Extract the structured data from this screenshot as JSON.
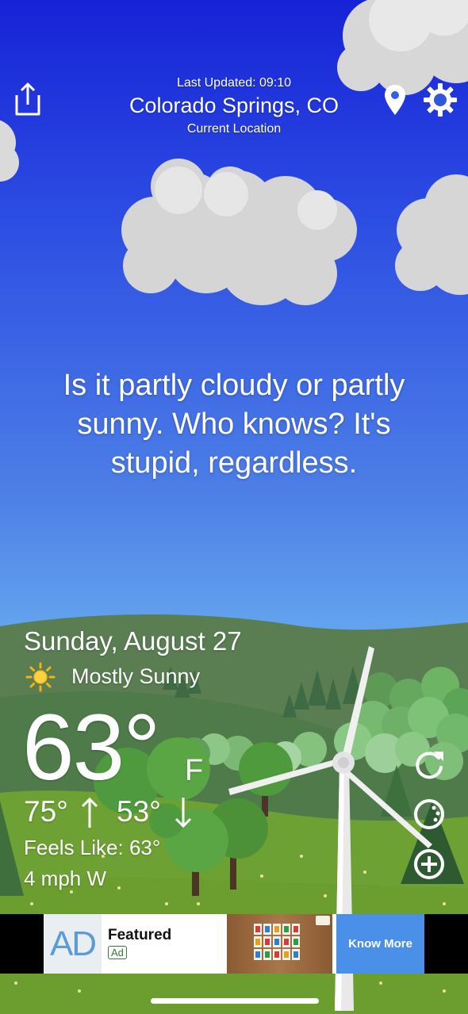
{
  "header": {
    "last_updated": "Last Updated: 09:10",
    "city": "Colorado Springs, CO",
    "subtitle": "Current Location"
  },
  "quip": "Is it partly cloudy or partly sunny. Who knows? It's stupid, regardless.",
  "weather": {
    "date": "Sunday, August 27",
    "condition": "Mostly Sunny",
    "temperature": "63°",
    "unit": "F",
    "high": "75°",
    "low": "53°",
    "feels_like": "Feels Like: 63°",
    "wind": "4 mph W"
  },
  "ad": {
    "logo": "AD",
    "title": "Featured",
    "tag": "Ad",
    "cta": "Know More"
  },
  "icons": {
    "share": "share-icon",
    "location": "location-pin-icon",
    "settings": "gear-icon",
    "refresh": "refresh-icon",
    "theme": "palette-icon",
    "add": "plus-circle-icon",
    "weather": "sun-icon"
  },
  "colors": {
    "sky_top": "#1622d6",
    "sky_bottom": "#7ab8f3",
    "grass": "#6b9e2f",
    "ad_cta": "#4a8fe8"
  }
}
